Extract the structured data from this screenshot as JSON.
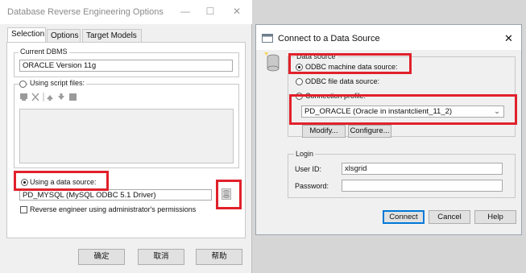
{
  "left": {
    "title": "Database Reverse Engineering Options",
    "window_controls": {
      "minimize": "—",
      "maximize": "☐",
      "close": "✕"
    },
    "tabs": [
      "Selection",
      "Options",
      "Target Models"
    ],
    "current_dbms_label": "Current DBMS",
    "current_dbms_value": "ORACLE Version 11g",
    "script_files_label": "Using script files:",
    "data_source_label": "Using a data source:",
    "data_source_value": "PD_MYSQL (MySQL ODBC 5.1 Driver)",
    "admin_check_label": "Reverse engineer using administrator's permissions",
    "buttons": {
      "ok": "确定",
      "cancel": "取消",
      "help": "帮助"
    }
  },
  "right": {
    "title": "Connect to a Data Source",
    "close": "✕",
    "data_source_group": "Data source",
    "options": {
      "machine": "ODBC machine data source:",
      "file": "ODBC file data source:",
      "profile": "Connection profile:"
    },
    "selected_source": "PD_ORACLE (Oracle in instantclient_11_2)",
    "modify": "Modify...",
    "configure": "Configure...",
    "login_group": "Login",
    "user_id_label": "User ID:",
    "user_id_value": "xlsgrid",
    "password_label": "Password:",
    "password_value": "",
    "buttons": {
      "connect": "Connect",
      "cancel": "Cancel",
      "help": "Help"
    }
  },
  "colors": {
    "highlight": "#e0212b",
    "selection_blue": "#0078d7"
  }
}
